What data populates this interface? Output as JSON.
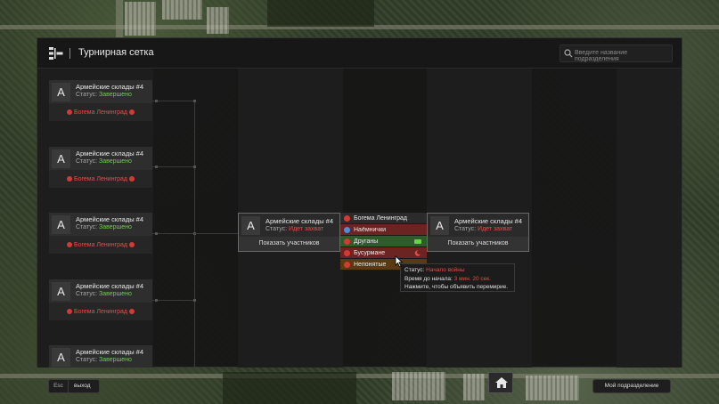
{
  "header": {
    "title": "Турнирная сетка",
    "search_placeholder": "Введите название подразделения"
  },
  "left_matches": [
    {
      "letter": "A",
      "name": "Армейские склады #4",
      "status_label": "Статус:",
      "status_value": "Завершено",
      "team": "Богема Ленинград"
    },
    {
      "letter": "A",
      "name": "Армейские склады #4",
      "status_label": "Статус:",
      "status_value": "Завершено",
      "team": "Богема Ленинград"
    },
    {
      "letter": "A",
      "name": "Армейские склады #4",
      "status_label": "Статус:",
      "status_value": "Завершено",
      "team": "Богема Ленинград"
    },
    {
      "letter": "A",
      "name": "Армейские склады #4",
      "status_label": "Статус:",
      "status_value": "Завершено",
      "team": "Богема Ленинград"
    },
    {
      "letter": "A",
      "name": "Армейские склады #4",
      "status_label": "Статус:",
      "status_value": "Завершено",
      "team": ""
    }
  ],
  "mid_match": {
    "letter": "A",
    "name": "Армейские склады #4",
    "status_label": "Статус:",
    "status_value": "Идет захват",
    "button": "Показать участников"
  },
  "right_match": {
    "letter": "A",
    "name": "Армейские склады #4",
    "status_label": "Статус:",
    "status_value": "Идет захват",
    "button": "Показать участников"
  },
  "teams": [
    {
      "name": "Богема Ленинград",
      "bg": "#2b2b2b",
      "icon_color": "#d43a34"
    },
    {
      "name": "Наёмнички",
      "bg": "#6b2422",
      "icon_color": "#4a90d9"
    },
    {
      "name": "Друганы",
      "bg": "#2f5a2a",
      "icon_color": "#d43a34"
    },
    {
      "name": "Бусурмане",
      "bg": "#6b2422",
      "icon_color": "#d43a34"
    },
    {
      "name": "Непонятые",
      "bg": "#5a3a12",
      "icon_color": "#d43a34"
    }
  ],
  "tooltip": {
    "status_label": "Статус:",
    "status_value": "Начало войны",
    "time_label": "Время до начала:",
    "time_value": "3 мин. 20 сек.",
    "hint": "Нажмите, чтобы объявить перемирие."
  },
  "footer": {
    "esc": "Esc",
    "exit": "выход",
    "my_unit": "Мой подразделение"
  }
}
